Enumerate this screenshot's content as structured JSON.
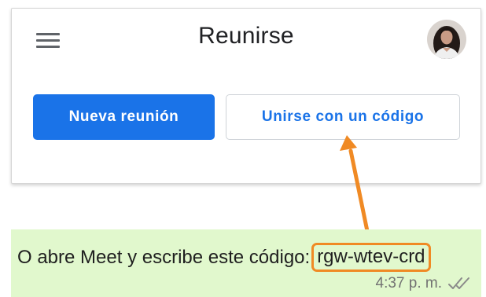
{
  "meet_card": {
    "title": "Reunirse",
    "new_meeting_label": "Nueva reunión",
    "join_with_code_label": "Unirse con un código",
    "menu_icon": "hamburger-menu-icon",
    "avatar_icon": "user-avatar"
  },
  "message": {
    "text": "O abre Meet y escribe este código:",
    "code": "rgw-wtev-crd",
    "time": "4:37 p. m.",
    "status_icon": "double-check-icon"
  },
  "colors": {
    "primary_blue": "#1a73e8",
    "annotation_orange": "#f08a24",
    "message_bubble": "#e1f8cd",
    "read_ticks": "#8a8a8a"
  }
}
